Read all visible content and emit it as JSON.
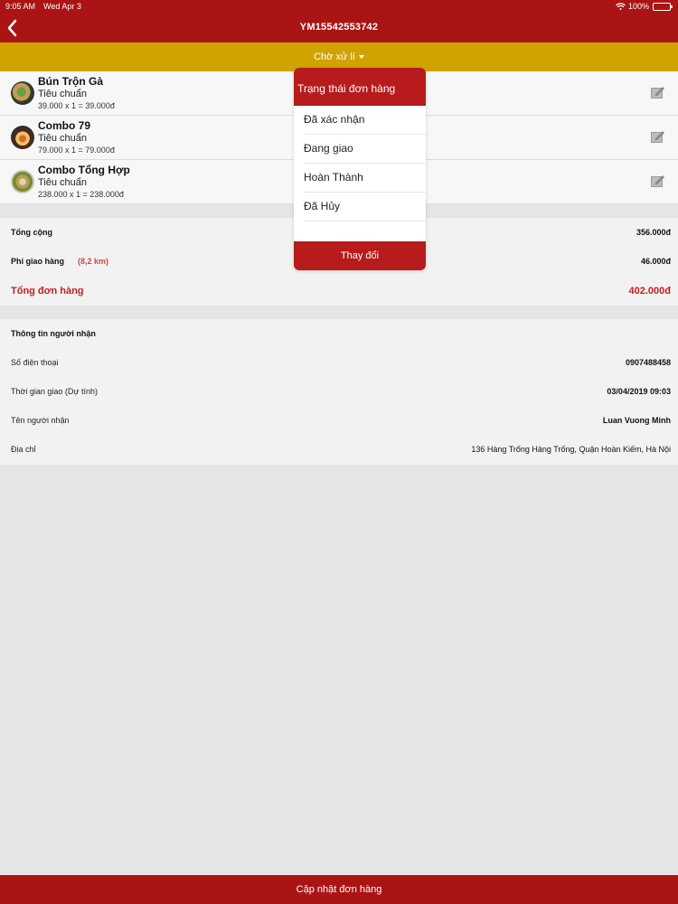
{
  "statusbar": {
    "time": "9:05 AM",
    "date": "Wed Apr 3",
    "battery": "100%"
  },
  "header": {
    "title": "YM15542553742"
  },
  "order_status": {
    "label": "Chờ xử lí"
  },
  "products": [
    {
      "name": "Bún Trộn Gà",
      "variant": "Tiêu chuẩn",
      "calc": "39.000 x 1 = 39.000đ"
    },
    {
      "name": "Combo 79",
      "variant": "Tiêu chuẩn",
      "calc": "79.000 x 1 = 79.000đ"
    },
    {
      "name": "Combo Tổng Hợp",
      "variant": "Tiêu chuẩn",
      "calc": "238.000 x 1 = 238.000đ"
    }
  ],
  "totals": {
    "subtotal_label": "Tổng cộng",
    "subtotal_value": "356.000đ",
    "shipping_label": "Phí giao hàng",
    "shipping_distance": "(8,2 km)",
    "shipping_value": "46.000đ",
    "grand_label": "Tổng đơn hàng",
    "grand_value": "402.000đ"
  },
  "receiver": {
    "title": "Thông tin người nhận",
    "phone_label": "Số điện thoại",
    "phone_value": "0907488458",
    "time_label": "Thời gian giao (Dự tính)",
    "time_value": "03/04/2019 09:03",
    "name_label": "Tên người nhận",
    "name_value": "Luan Vuong Minh",
    "address_label": "Địa chỉ",
    "address_value": "136 Hàng Trống Hàng Trống, Quận Hoàn Kiếm, Hà Nội"
  },
  "popup": {
    "title": "Trạng thái đơn hàng",
    "options": [
      "Đã xác nhận",
      "Đang giao",
      "Hoàn Thành",
      "Đã Hủy"
    ],
    "button": "Thay đổi"
  },
  "bottom_button": "Cập nhật đơn hàng",
  "colors": {
    "primary": "#ab1414",
    "status_bar": "#d0a300",
    "accent_text": "#c21f1f"
  }
}
